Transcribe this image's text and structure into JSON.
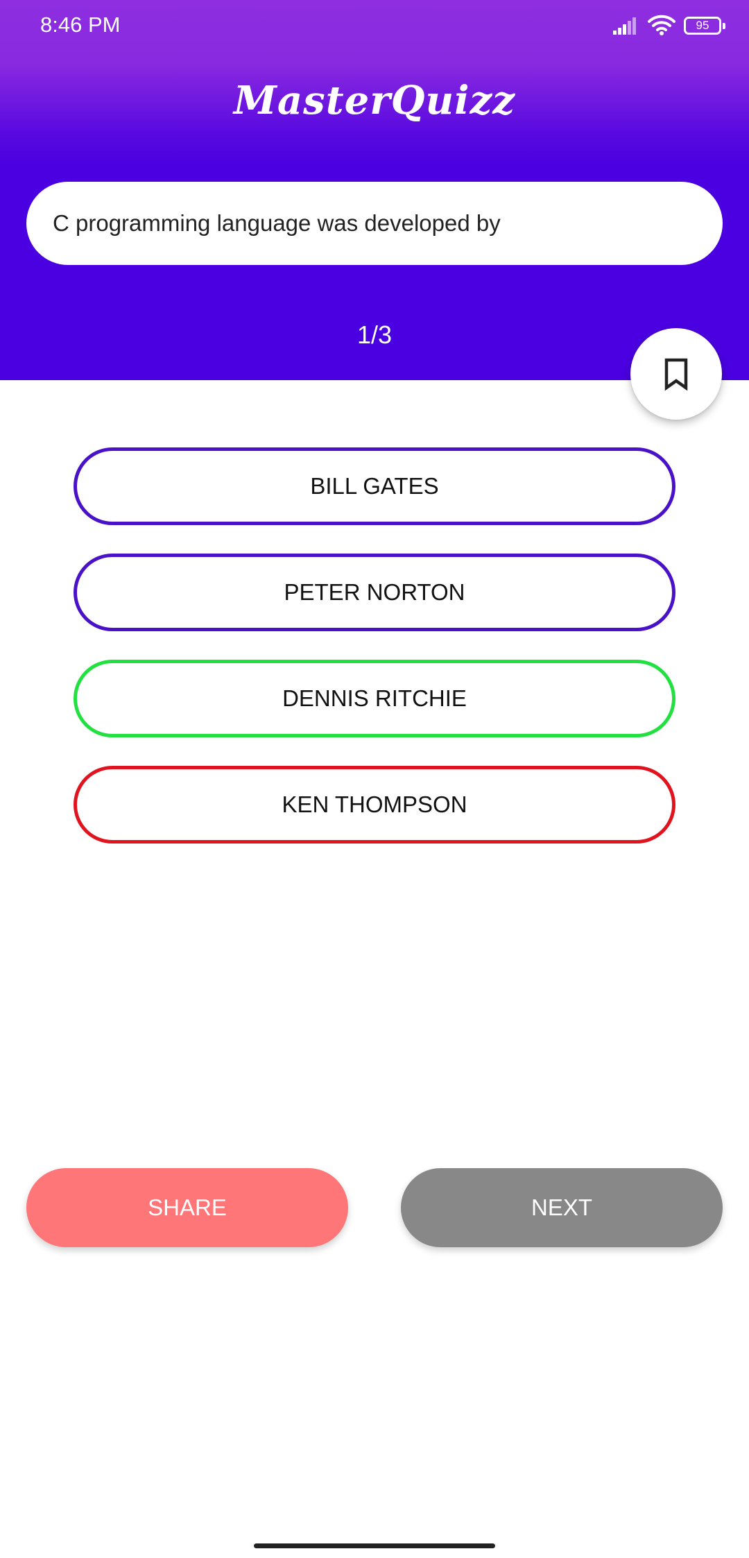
{
  "status_bar": {
    "time": "8:46 PM",
    "battery_level": "95",
    "signal_icon": "signal-bars-icon",
    "wifi_icon": "wifi-icon"
  },
  "app": {
    "title": "MasterQuizz",
    "brand_color": "#4a00e0",
    "gradient_top": "#8e2ee0"
  },
  "quiz": {
    "question": "C programming language was developed by",
    "progress": "1/3",
    "bookmark_icon": "bookmark-icon",
    "options": [
      {
        "label": "BILL GATES",
        "state": "default",
        "color": "#4a12c8"
      },
      {
        "label": "PETER NORTON",
        "state": "default",
        "color": "#4a12c8"
      },
      {
        "label": "DENNIS RITCHIE",
        "state": "correct",
        "color": "#22e040"
      },
      {
        "label": "KEN THOMPSON",
        "state": "wrong",
        "color": "#e0141e"
      }
    ]
  },
  "actions": {
    "share_label": "SHARE",
    "share_color": "#ff7679",
    "next_label": "NEXT",
    "next_color": "#888888"
  }
}
